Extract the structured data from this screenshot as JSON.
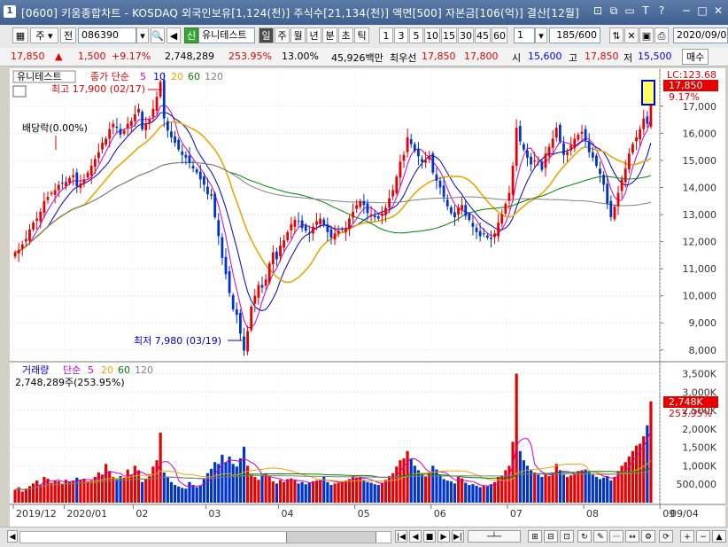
{
  "window": {
    "number": "1",
    "title": "[0600] 키움종합차트 - KOSDAQ 외국인보유[1,124(천)] 주식수[21,134(천)] 액면[500] 자본금[106(억)] 결산[12월]",
    "controls": [
      "⊡",
      "⧉",
      "▭",
      "T",
      "?",
      "─",
      "□",
      "✕"
    ]
  },
  "toolbar": {
    "period_label": "주",
    "prev_label": "전",
    "code": "086390",
    "badge": "신",
    "stock_name": "유니테스트",
    "periods": [
      "일",
      "주",
      "월",
      "년",
      "분",
      "초",
      "틱"
    ],
    "selected_period": "일",
    "minutes": [
      "1",
      "3",
      "5",
      "10",
      "15",
      "30",
      "45",
      "60"
    ],
    "unit_value": "1",
    "count": "185/600",
    "date": "2020/09/0"
  },
  "quote": {
    "price": "17,850",
    "arrow": "▲",
    "change": "1,500",
    "change_pct": "+9.17%",
    "volume": "2,748,289",
    "vol_pct": "253.95%",
    "turnover": "13.00%",
    "amount": "45,926백만",
    "ask_label": "최우선",
    "ask1": "17,850",
    "bid1": "17,800",
    "open_label": "시",
    "open": "15,600",
    "high_label": "고",
    "high": "17,850",
    "low_label": "저",
    "low": "15,500",
    "buy_label": "매수"
  },
  "price_panel": {
    "stock_tag": "유니테스트",
    "legend_prefix": "종가 단순",
    "ma_labels": [
      "5",
      "10",
      "20",
      "60",
      "120"
    ],
    "lc_label": "LC:123.68",
    "price_tag": "17,850",
    "pct_tag": "9.17%",
    "high_note": "최고 17,900 (02/17)",
    "low_note": "최저 7,980 (03/19)",
    "dividend_note": "배당락(0.00%)"
  },
  "volume_panel": {
    "label": "거래량",
    "legend_prefix": "단순",
    "ma_labels": [
      "5",
      "20",
      "60",
      "120"
    ],
    "value_line": "2,748,289주(253.95%)",
    "vol_tag": "2,748K",
    "pct_tag": "253.95%"
  },
  "colors": {
    "up": "#e60000",
    "down": "#0033cc",
    "ma5": "#cc00cc",
    "ma10": "#0000cc",
    "ma20": "#e8a800",
    "ma60": "#008000",
    "ma120": "#808080"
  },
  "chart_data": {
    "type": "candlestick",
    "price_axis": {
      "ticks": [
        "17,000",
        "16,000",
        "15,000",
        "14,000",
        "13,000",
        "12,000",
        "11,000",
        "10,000",
        "9,000",
        "8,000"
      ],
      "range": [
        7600,
        18400
      ]
    },
    "volume_axis": {
      "ticks": [
        "3,500K",
        "3,000K",
        "2,500K",
        "2,000K",
        "1,500K",
        "1,000K",
        "500,000"
      ],
      "range": [
        0,
        3800
      ]
    },
    "date_labels": [
      "2019/12",
      "2020/01",
      "02",
      "03",
      "04",
      "05",
      "06",
      "07",
      "08",
      "09"
    ],
    "date_index": [
      0,
      14,
      33,
      53,
      73,
      94,
      115,
      136,
      157,
      178
    ],
    "end_label": "09/04",
    "closes": [
      11600,
      11700,
      11900,
      12100,
      12450,
      12700,
      12850,
      13100,
      13500,
      13650,
      13800,
      13900,
      14100,
      14150,
      14200,
      14350,
      14450,
      14050,
      14150,
      14300,
      14550,
      14800,
      15050,
      15300,
      15650,
      15800,
      16150,
      16350,
      16200,
      15950,
      16100,
      16350,
      16450,
      16700,
      16900,
      16150,
      16350,
      16500,
      16900,
      17350,
      17900,
      16550,
      16100,
      15850,
      15650,
      15400,
      15200,
      15100,
      14900,
      14700,
      14550,
      14300,
      14100,
      13750,
      13700,
      12900,
      12200,
      11400,
      10800,
      10100,
      9500,
      9300,
      8600,
      7980,
      8700,
      9600,
      10000,
      10400,
      10300,
      10600,
      11200,
      11600,
      11350,
      11850,
      12050,
      12350,
      12650,
      12800,
      12750,
      12500,
      12400,
      12300,
      12550,
      12750,
      12850,
      12600,
      12350,
      12150,
      12300,
      12400,
      12450,
      12500,
      12850,
      13100,
      13350,
      13500,
      13350,
      13050,
      13000,
      12900,
      12850,
      13050,
      13250,
      13600,
      13900,
      14400,
      14950,
      15200,
      15850,
      15600,
      15350,
      15150,
      14950,
      15000,
      15150,
      14550,
      14250,
      14000,
      13650,
      13300,
      13050,
      12900,
      13250,
      13350,
      12950,
      12800,
      12550,
      12350,
      12200,
      12300,
      12150,
      12100,
      12300,
      12700,
      13000,
      13400,
      13800,
      14800,
      16200,
      15700,
      15400,
      15100,
      14850,
      15000,
      14950,
      14650,
      15250,
      15500,
      15800,
      16200,
      15700,
      15200,
      15300,
      15550,
      15800,
      15950,
      16050,
      15750,
      15300,
      15100,
      14800,
      14500,
      14100,
      13400,
      12900,
      13300,
      13800,
      14300,
      14700,
      15250,
      15600,
      15850,
      16150,
      16550,
      16350,
      17850
    ],
    "volumes": [
      350,
      420,
      300,
      380,
      450,
      520,
      600,
      480,
      700,
      650,
      540,
      600,
      580,
      500,
      620,
      560,
      600,
      680,
      620,
      650,
      580,
      600,
      700,
      820,
      760,
      1050,
      860,
      700,
      640,
      720,
      680,
      900,
      760,
      1000,
      880,
      560,
      640,
      720,
      980,
      1150,
      1900,
      820,
      700,
      560,
      480,
      440,
      400,
      380,
      560,
      480,
      420,
      460,
      640,
      800,
      920,
      1100,
      1050,
      1300,
      1100,
      1250,
      1050,
      980,
      1200,
      1520,
      1000,
      760,
      700,
      620,
      740,
      800,
      700,
      580,
      520,
      620,
      560,
      640,
      660,
      600,
      520,
      560,
      500,
      540,
      580,
      600,
      620,
      700,
      560,
      480,
      520,
      540,
      580,
      600,
      640,
      720,
      680,
      700,
      620,
      560,
      540,
      500,
      480,
      540,
      620,
      720,
      800,
      980,
      1150,
      1200,
      1400,
      1200,
      1000,
      880,
      760,
      700,
      820,
      1000,
      900,
      760,
      640,
      600,
      580,
      520,
      700,
      660,
      540,
      480,
      500,
      460,
      420,
      460,
      440,
      500,
      560,
      700,
      720,
      880,
      1000,
      1650,
      3500,
      1400,
      1150,
      1000,
      880,
      820,
      760,
      700,
      780,
      720,
      820,
      1050,
      880,
      760,
      700,
      740,
      800,
      860,
      880,
      900,
      820,
      760,
      700,
      640,
      680,
      720,
      600,
      700,
      860,
      1000,
      1100,
      1250,
      1400,
      1550,
      1600,
      1800,
      2100,
      2748
    ]
  }
}
